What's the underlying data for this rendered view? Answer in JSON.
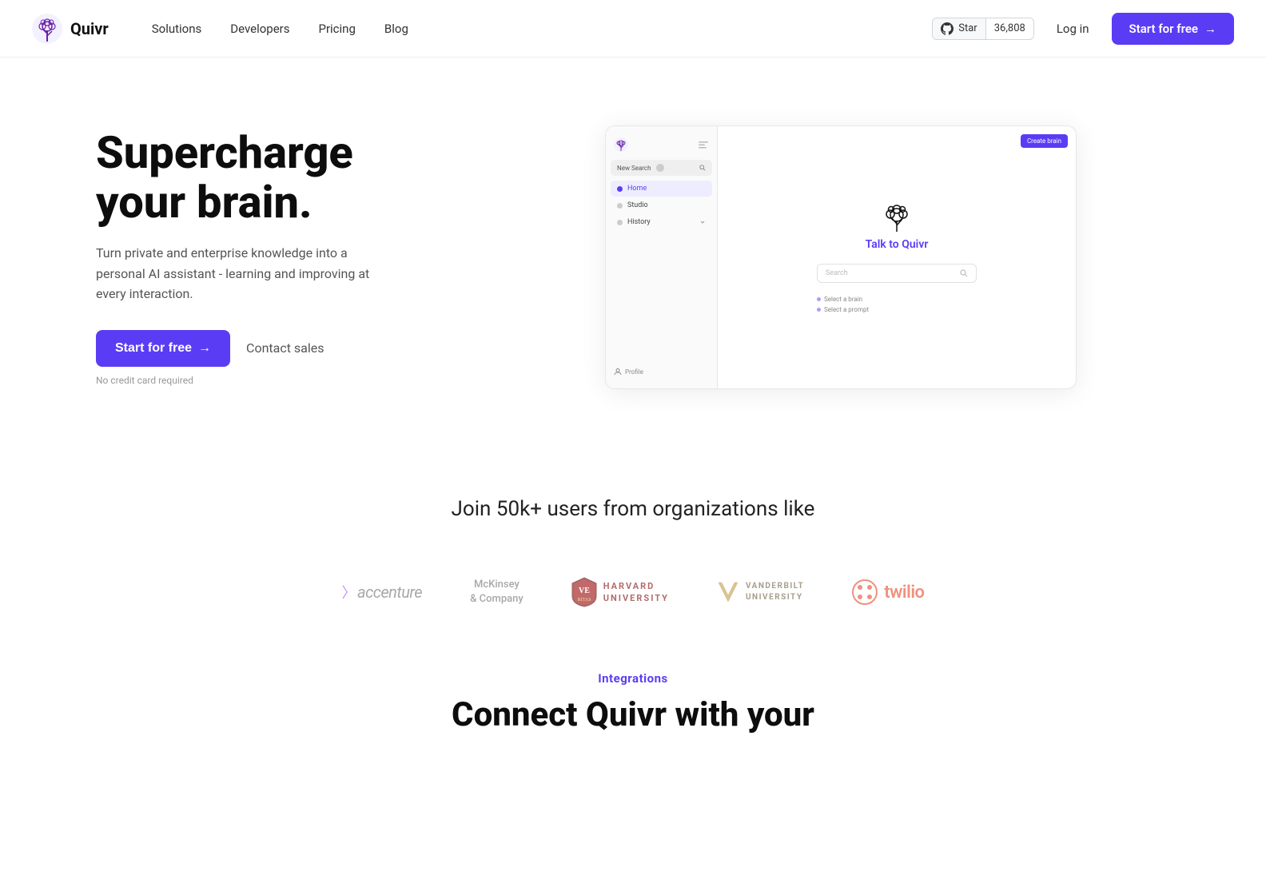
{
  "brand": {
    "name": "Quivr",
    "logo_alt": "Quivr tree logo"
  },
  "nav": {
    "links": [
      {
        "label": "Solutions",
        "id": "solutions"
      },
      {
        "label": "Developers",
        "id": "developers"
      },
      {
        "label": "Pricing",
        "id": "pricing"
      },
      {
        "label": "Blog",
        "id": "blog"
      }
    ],
    "github_star_label": "Star",
    "github_star_count": "36,808",
    "login_label": "Log in",
    "cta_label": "Start for free",
    "cta_arrow": "→"
  },
  "hero": {
    "title_line1": "Supercharge",
    "title_line2": "your brain.",
    "subtitle": "Turn private and enterprise knowledge into a personal AI assistant - learning and improving at every interaction.",
    "cta_label": "Start for free",
    "cta_arrow": "→",
    "contact_label": "Contact sales",
    "no_cc": "No credit card required"
  },
  "app_preview": {
    "sidebar_nav": [
      {
        "label": "Home",
        "id": "home"
      },
      {
        "label": "Studio",
        "id": "studio"
      },
      {
        "label": "History",
        "id": "history"
      }
    ],
    "search_tab_label": "New Search",
    "create_brain_label": "Create brain",
    "main_title_prefix": "Talk to ",
    "main_title_brand": "Quivr",
    "search_placeholder": "Search",
    "hint1": "Select a brain",
    "hint2": "Select a prompt",
    "profile_label": "Profile"
  },
  "join": {
    "title": "Join 50k+ users from organizations like"
  },
  "logos": [
    {
      "name": "accenture",
      "display": "accenture"
    },
    {
      "name": "mckinsey",
      "line1": "McKinsey",
      "line2": "& Company"
    },
    {
      "name": "harvard",
      "line1": "HARVARD",
      "line2": "UNIVERSITY"
    },
    {
      "name": "vanderbilt",
      "line1": "VANDERBILT",
      "line2": "UNIVERSITY"
    },
    {
      "name": "twilio",
      "display": "twilio"
    }
  ],
  "integrations": {
    "label": "Integrations",
    "title_partial": "Connect Quivr with your"
  }
}
